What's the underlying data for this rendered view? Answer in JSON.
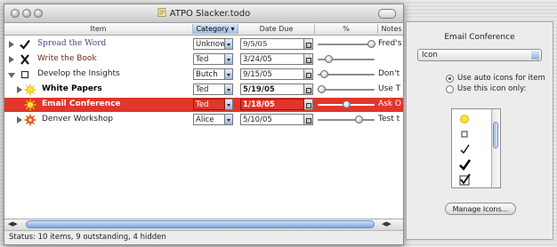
{
  "window": {
    "title": "ATPO Slacker.todo",
    "status": "Status: 10 items, 9 outstanding, 4 hidden"
  },
  "columns": {
    "item": "Item",
    "category": "Category",
    "date_due": "Date Due",
    "percent": "%",
    "notes": "Notes"
  },
  "rows": [
    {
      "icon": "checkmark-icon",
      "item": "Spread the Word",
      "item_color": "#5a3d8a",
      "category": "Unknow",
      "date": "9/5/05",
      "progress": 1.0,
      "note": "Fred's",
      "expanded": false,
      "selected": false,
      "bold": false
    },
    {
      "icon": "x-mark-icon",
      "item": "Write the Book",
      "item_color": "#6a2a18",
      "category": "Ted",
      "date": "3/24/05",
      "progress": 0.15,
      "note": "",
      "expanded": false,
      "selected": false,
      "bold": false
    },
    {
      "icon": "checkbox-icon",
      "item": "Develop the Insights",
      "item_color": "#222222",
      "category": "Butch",
      "date": "9/15/05",
      "progress": 0.05,
      "note": "Don't",
      "expanded": true,
      "selected": false,
      "bold": false
    },
    {
      "icon": "sun-icon",
      "item": "White Papers",
      "item_color": "#000000",
      "category": "Ted",
      "date": "5/19/05",
      "progress": 0.0,
      "note": "Use T",
      "expanded": false,
      "selected": false,
      "bold": true
    },
    {
      "icon": "sun-icon",
      "item": "Email Conference",
      "item_color": "#ffffff",
      "category": "Ted",
      "date": "1/18/05",
      "progress": 0.5,
      "note": "Ask O",
      "expanded": false,
      "selected": true,
      "bold": true
    },
    {
      "icon": "sunburst-red-icon",
      "item": "Denver Workshop",
      "item_color": "#222222",
      "category": "Alice",
      "date": "5/10/05",
      "progress": 0.75,
      "note": "Test t",
      "expanded": false,
      "selected": false,
      "bold": false
    }
  ],
  "panel": {
    "title": "Email Conference",
    "select_value": "Icon",
    "radio_auto": "Use auto icons for item",
    "radio_only": "Use this icon only:",
    "manage_button": "Manage Icons...",
    "icons": [
      "sun-icon",
      "checkbox-icon",
      "checkmark-thin-icon",
      "checkmark-bold-icon",
      "checked-box-icon"
    ]
  },
  "colors": {
    "selection": "#e0362b",
    "accent": "#7ea6dc"
  }
}
